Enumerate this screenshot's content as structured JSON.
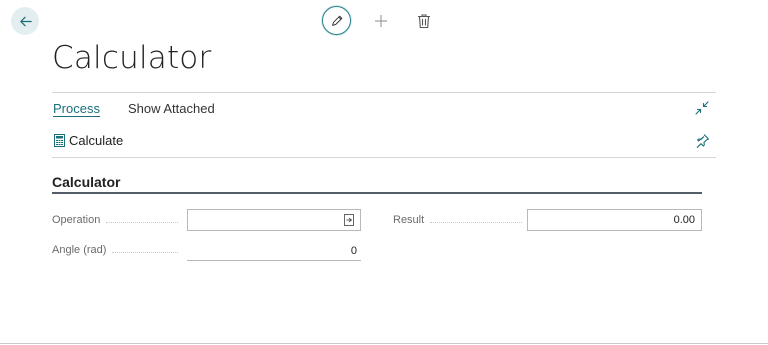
{
  "header": {
    "title": "Calculator"
  },
  "actions": {
    "tabs": [
      "Process",
      "Show Attached"
    ],
    "calculate_label": "Calculate"
  },
  "section": {
    "title": "Calculator"
  },
  "fields": {
    "operation": {
      "label": "Operation",
      "value": ""
    },
    "angle": {
      "label": "Angle (rad)",
      "value": "0"
    },
    "result": {
      "label": "Result",
      "value": "0.00"
    }
  },
  "colors": {
    "accent": "#1a6f7b",
    "back_button_bg": "#e3eef0",
    "section_rule": "#545e69"
  },
  "icons": {
    "back": "arrow-left-icon",
    "edit": "pencil-icon",
    "new": "plus-icon",
    "delete": "trash-icon",
    "collapse": "collapse-arrows-icon",
    "pin": "pin-icon",
    "calculate": "calculator-icon",
    "lookup": "lookup-icon"
  }
}
